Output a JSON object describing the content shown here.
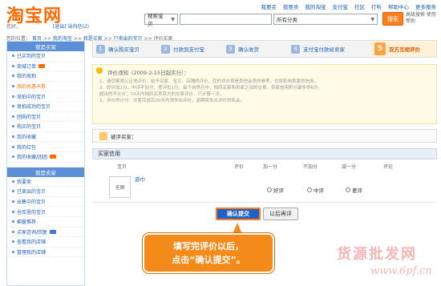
{
  "header": {
    "logo": "淘宝网",
    "welcome_prefix": "您好，",
    "logout": "[退出]",
    "site_msg": "站内信(2)",
    "topnav": [
      "我要买",
      "我要卖",
      "我的淘宝",
      "支付宝",
      "社区",
      "打听",
      "帮助中心",
      "更多服务"
    ],
    "search_category": "搜索宝贝",
    "search_all": "所有分类",
    "search_button": "搜索",
    "search_help": "高级搜索 使用帮助"
  },
  "breadcrumb": {
    "prefix": "您的位置：",
    "items": [
      "首页",
      "我的淘宝",
      "我是买家",
      "已卖出的宝贝",
      "评价买家"
    ]
  },
  "sidebar": {
    "buyer_title": "我是买家",
    "buyer_items": [
      "已买到的宝贝",
      "商城订单",
      "我的竞拍",
      "我的优惠卡券",
      "竞拍中的宝贝",
      "竞拍成功的宝贝",
      "团购的宝贝",
      "购买的宝贝",
      "我的收藏",
      "我的红包",
      "我的收藏/团团"
    ],
    "seller_title": "我是卖家",
    "seller_items": [
      "我要卖",
      "已卖出的宝贝",
      "出售中的宝贝",
      "仓库里的宝贝",
      "橱窗推荐",
      "买家咨询/回复",
      "查看我的店铺",
      "管理我的店铺"
    ]
  },
  "steps": [
    {
      "num": "1",
      "label": "确认购买宝贝"
    },
    {
      "num": "2",
      "label": "付款到支付宝"
    },
    {
      "num": "3",
      "label": "确认收货"
    },
    {
      "num": "4",
      "label": "支付宝付款给卖家"
    },
    {
      "num": "5",
      "label": "双方互相评价"
    }
  ],
  "notice": {
    "title": "评价须知（2009-2-15日起实行）：",
    "lines": [
      "1、请您客观公正地评价，给予买家、宝贝、店铺的评价，您的评价将是其他会员的参考，也将影响卖家的信用。",
      "2、好评加1分，中评不加分，差评扣1分。每个自然月中，相同买家和卖家之间的交易，卖家信用积分最多得6分，",
      "   超出的不计分；14天内相同买卖双方的交易评价，只计算一次。",
      "3、评价的计分：交易完成后30天内须作出评价，逾期将失去评价的机会。"
    ]
  },
  "seller": {
    "label": "被评买家：",
    "name": ""
  },
  "rating": {
    "title": "买家信用",
    "col_item": "宝贝",
    "col_rate": "评价",
    "col_plus": "加一分",
    "col_zero": "不加分",
    "col_minus": "减一分",
    "col_comment": "评论",
    "item_image": "无图",
    "item_name": "道巾",
    "options": [
      "好评",
      "中评",
      "差评"
    ]
  },
  "actions": {
    "submit": "确认提交",
    "later": "以后再评"
  },
  "callout": {
    "line1": "填写完评价以后，",
    "line2": "点击“确认提交”。"
  },
  "watermark": {
    "cn": "货源批发网",
    "url": "www.6pf.cn"
  }
}
